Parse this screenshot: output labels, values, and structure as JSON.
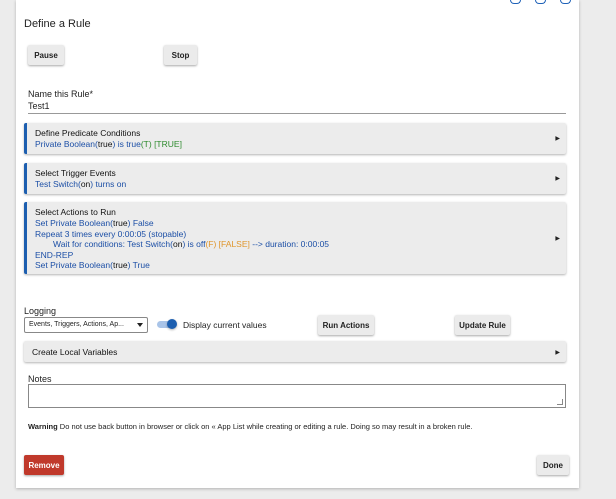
{
  "page": {
    "title": "Define a Rule"
  },
  "controls": {
    "pause_label": "Pause",
    "stop_label": "Stop"
  },
  "name_field": {
    "label": "Name this Rule*",
    "value": "Test1"
  },
  "predicate": {
    "heading": "Define Predicate Conditions",
    "line_a": "Private Boolean(",
    "line_b": "true",
    "line_c": ") is true",
    "line_d": "(T)",
    "line_e": " [TRUE]"
  },
  "triggers": {
    "heading": "Select Trigger Events",
    "line_a": "Test Switch(",
    "line_b": "on",
    "line_c": ") turns on"
  },
  "actions": {
    "heading": "Select Actions to Run",
    "l1_a": "Set Private Boolean(",
    "l1_b": "true",
    "l1_c": ") False",
    "l2": "Repeat 3 times every 0:00:05 (stopable)",
    "l3_a": "Wait for conditions: Test Switch(",
    "l3_b": "on",
    "l3_c": ") is off",
    "l3_d": "(F) [FALSE]",
    "l3_e": "  --> duration: 0:00:05",
    "l4": "END-REP",
    "l5_a": "Set Private Boolean(",
    "l5_b": "true",
    "l5_c": ") True"
  },
  "logging": {
    "label": "Logging",
    "selected": "Events, Triggers, Actions, Ap...",
    "toggle_label": "Display current values",
    "toggle_on": true,
    "run_actions_label": "Run Actions",
    "update_rule_label": "Update Rule"
  },
  "local_variables": {
    "heading": "Create Local Variables"
  },
  "notes": {
    "label": "Notes",
    "value": ""
  },
  "warning": {
    "bold": "Warning",
    "text": " Do not use back button in browser or click on « App List while creating or editing a rule. Doing so may result in a broken rule."
  },
  "footer": {
    "remove_label": "Remove",
    "done_label": "Done"
  },
  "colors": {
    "accent": "#1d5fb0",
    "danger": "#c0392b",
    "true_green": "#2e8b2e",
    "false_orange": "#e0962c"
  }
}
